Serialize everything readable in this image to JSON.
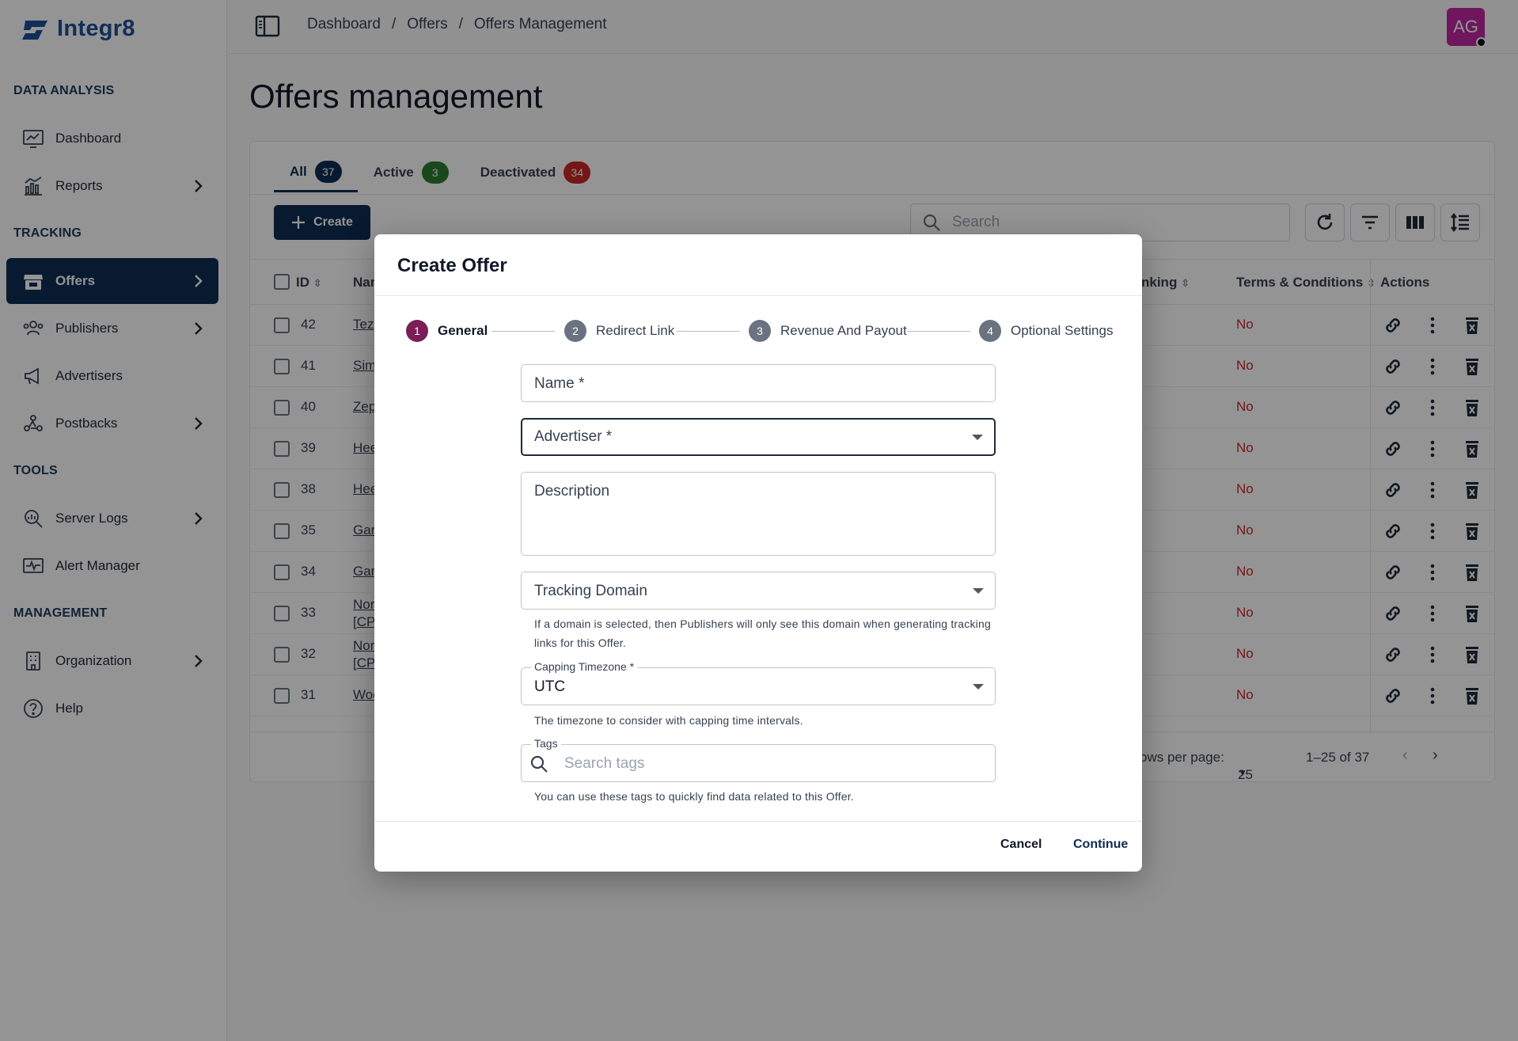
{
  "app": {
    "brand": "Integr8"
  },
  "sidebar": {
    "sections": {
      "data_analysis": "DATA ANALYSIS",
      "tracking": "TRACKING",
      "tools": "TOOLS",
      "management": "MANAGEMENT"
    },
    "items": {
      "dashboard": "Dashboard",
      "reports": "Reports",
      "offers": "Offers",
      "publishers": "Publishers",
      "advertisers": "Advertisers",
      "postbacks": "Postbacks",
      "server_logs": "Server Logs",
      "alert_manager": "Alert Manager",
      "organization": "Organization",
      "help": "Help"
    }
  },
  "header": {
    "breadcrumb": [
      "Dashboard",
      "Offers",
      "Offers Management"
    ],
    "separator": "/",
    "avatar_initials": "AG"
  },
  "page": {
    "title": "Offers management",
    "tabs": [
      {
        "label": "All",
        "count": "37"
      },
      {
        "label": "Active",
        "count": "3"
      },
      {
        "label": "Deactivated",
        "count": "34"
      }
    ],
    "create_label": "Create",
    "search_placeholder": "Search",
    "columns": {
      "id": "ID",
      "name": "Nar",
      "ranking": "nking",
      "terms": "Terms & Conditions",
      "actions": "Actions"
    },
    "rows": [
      {
        "id": "42",
        "name": "Tez",
        "terms": "No"
      },
      {
        "id": "41",
        "name": "Sim",
        "terms": "No"
      },
      {
        "id": "40",
        "name": "Zep",
        "terms": "No"
      },
      {
        "id": "39",
        "name": "Hee",
        "terms": "No"
      },
      {
        "id": "38",
        "name": "Hee",
        "terms": "No"
      },
      {
        "id": "35",
        "name": "Gar",
        "terms": "No"
      },
      {
        "id": "34",
        "name": "Gar",
        "terms": "No"
      },
      {
        "id": "33",
        "name": "Nor",
        "name2": "[CP/",
        "terms": "No"
      },
      {
        "id": "32",
        "name": "Nor",
        "name2": "[CP/",
        "terms": "No"
      },
      {
        "id": "31",
        "name": "Woo",
        "terms": "No"
      }
    ],
    "footer": {
      "rows_per_page_label": "ows per page:",
      "rows_per_page": "25",
      "range": "1–25 of 37"
    }
  },
  "dialog": {
    "title": "Create Offer",
    "steps": [
      {
        "num": "1",
        "label": "General"
      },
      {
        "num": "2",
        "label": "Redirect Link"
      },
      {
        "num": "3",
        "label": "Revenue And Payout"
      },
      {
        "num": "4",
        "label": "Optional Settings"
      }
    ],
    "fields": {
      "name_label": "Name *",
      "advertiser_label": "Advertiser *",
      "description_label": "Description",
      "tracking_domain_label": "Tracking Domain",
      "tracking_domain_help": "If a domain is selected, then Publishers will only see this domain when generating tracking links for this Offer.",
      "capping_timezone_label": "Capping Timezone *",
      "capping_timezone_value": "UTC",
      "capping_timezone_help": "The timezone to consider with capping time intervals.",
      "tags_label": "Tags",
      "tags_placeholder": "Search tags",
      "tags_help": "You can use these tags to quickly find data related to this Offer."
    },
    "cancel_label": "Cancel",
    "continue_label": "Continue"
  }
}
